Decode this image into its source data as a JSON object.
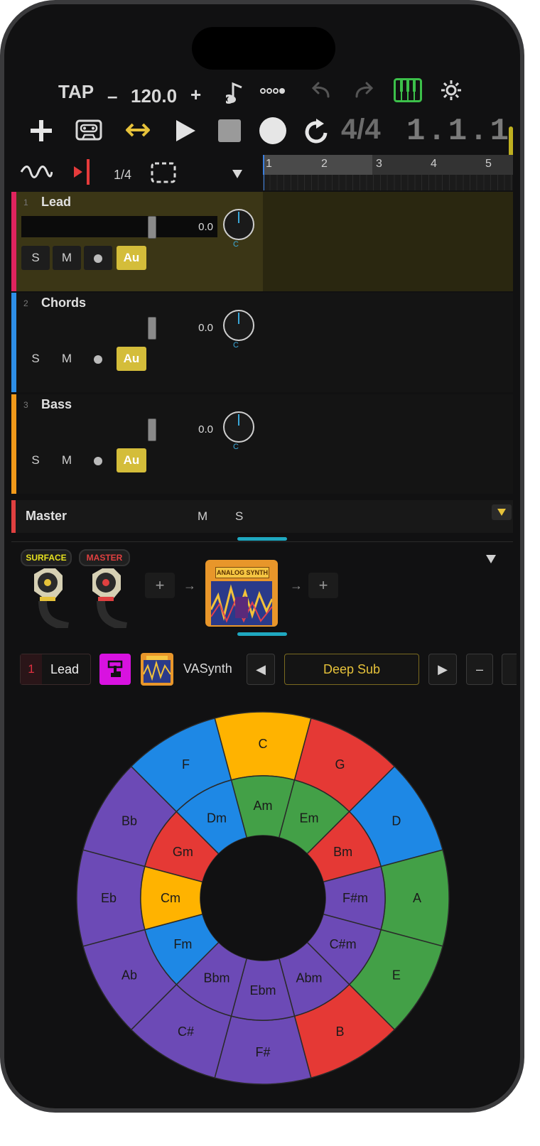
{
  "transport": {
    "tap_label": "TAP",
    "minus": "–",
    "tempo": "120.0",
    "plus": "+",
    "time_signature": "4/4",
    "position": "1.1.1"
  },
  "editor": {
    "quantize": "1/4",
    "ruler_bars": [
      "1",
      "2",
      "3",
      "4",
      "5"
    ]
  },
  "tracks": [
    {
      "number": "1",
      "name": "Lead",
      "volume": "0.0",
      "pan": "C",
      "solo": "S",
      "mute": "M",
      "au": "Au",
      "color": "#e0245e",
      "selected": true
    },
    {
      "number": "2",
      "name": "Chords",
      "volume": "0.0",
      "pan": "C",
      "solo": "S",
      "mute": "M",
      "au": "Au",
      "color": "#2e8fe8",
      "selected": false
    },
    {
      "number": "3",
      "name": "Bass",
      "volume": "0.0",
      "pan": "C",
      "solo": "S",
      "mute": "M",
      "au": "Au",
      "color": "#f29a1a",
      "selected": false
    }
  ],
  "master": {
    "name": "Master",
    "mute": "M",
    "solo": "S",
    "color": "#e04040"
  },
  "rack": {
    "surface_label": "SURFACE",
    "master_label": "MASTER",
    "plugin_label": "ANALOG SYNTH",
    "add": "+",
    "arrow": "→"
  },
  "instrument_bar": {
    "track_number": "1",
    "track_name": "Lead",
    "instrument": "VASynth",
    "preset": "Deep Sub",
    "prev": "◀",
    "next": "▶",
    "minus": "–"
  },
  "circle_of_fifths": {
    "colors": {
      "yellow": "#ffb300",
      "red": "#e53935",
      "blue": "#1e88e5",
      "green": "#43a047",
      "purple": "#6c4ab6"
    },
    "outer": [
      {
        "label": "C",
        "color": "yellow"
      },
      {
        "label": "G",
        "color": "red"
      },
      {
        "label": "D",
        "color": "blue"
      },
      {
        "label": "A",
        "color": "green"
      },
      {
        "label": "E",
        "color": "green"
      },
      {
        "label": "B",
        "color": "red"
      },
      {
        "label": "F#",
        "color": "purple"
      },
      {
        "label": "C#",
        "color": "purple"
      },
      {
        "label": "Ab",
        "color": "purple"
      },
      {
        "label": "Eb",
        "color": "purple"
      },
      {
        "label": "Bb",
        "color": "purple"
      },
      {
        "label": "F",
        "color": "blue"
      }
    ],
    "inner": [
      {
        "label": "Am",
        "color": "green"
      },
      {
        "label": "Em",
        "color": "green"
      },
      {
        "label": "Bm",
        "color": "red"
      },
      {
        "label": "F#m",
        "color": "purple"
      },
      {
        "label": "C#m",
        "color": "purple"
      },
      {
        "label": "Abm",
        "color": "purple"
      },
      {
        "label": "Ebm",
        "color": "purple"
      },
      {
        "label": "Bbm",
        "color": "purple"
      },
      {
        "label": "Fm",
        "color": "blue"
      },
      {
        "label": "Cm",
        "color": "yellow"
      },
      {
        "label": "Gm",
        "color": "red"
      },
      {
        "label": "Dm",
        "color": "blue"
      }
    ]
  }
}
